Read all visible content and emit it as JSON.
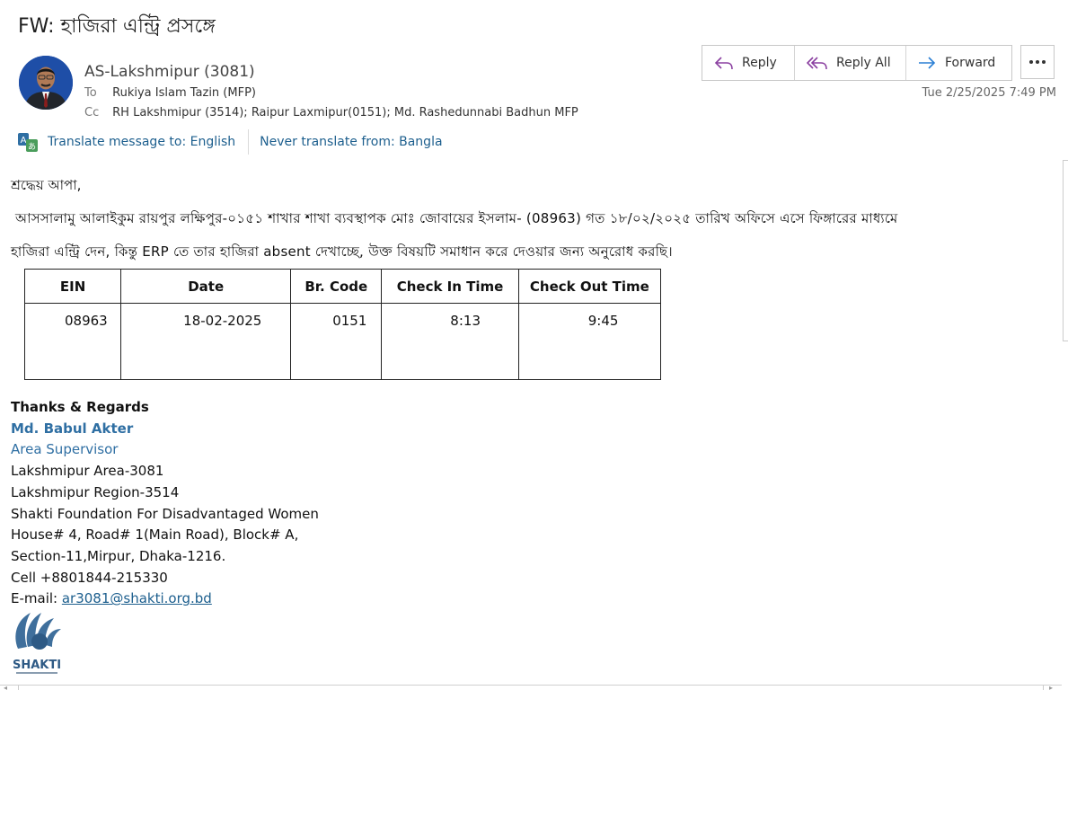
{
  "subject": "FW: হাজিরা এন্ট্রি প্রসঙ্গে",
  "header": {
    "sender": "AS-Lakshmipur (3081)",
    "to_label": "To",
    "to": "Rukiya Islam Tazin (MFP)",
    "cc_label": "Cc",
    "cc": "RH Lakshmipur (3514); Raipur Laxmipur(0151); Md. Rashedunnabi Badhun MFP",
    "timestamp": "Tue 2/25/2025 7:49 PM"
  },
  "toolbar": {
    "reply_label": "Reply",
    "reply_all_label": "Reply All",
    "forward_label": "Forward",
    "more_icon": "more-options-icon"
  },
  "translate": {
    "translate_label": "Translate message to: English",
    "never_label": "Never translate from: Bangla"
  },
  "body": {
    "salutation": "শ্রদ্ধেয় আপা,",
    "line2": "আসসালামু আলাইকুম রায়পুর লক্ষিপুর-০১৫১ শাখার শাখা ব্যবস্থাপক মোঃ জোবায়ের ইসলাম- (08963) গত ১৮/০২/২০২৫ তারিখ অফিসে এসে ফিঙ্গারের মাধ্যমে",
    "line3": "হাজিরা এন্ট্রি দেন, কিন্তু ERP তে তার হাজিরা absent দেখাচ্ছে, উক্ত বিষয়টি সমাধান করে দেওয়ার জন্য অনুরোধ করছি।"
  },
  "table": {
    "headers": [
      "EIN",
      "Date",
      "Br. Code",
      "Check In Time",
      "Check Out Time"
    ],
    "rows": [
      [
        "08963",
        "18-02-2025",
        "0151",
        "8:13",
        "9:45"
      ]
    ]
  },
  "signature": {
    "closing": "Thanks & Regards",
    "name": "Md. Babul Akter",
    "title": "Area Supervisor",
    "area": "Lakshmipur Area-3081",
    "region": "Lakshmipur Region-3514",
    "org": "Shakti Foundation For Disadvantaged Women",
    "address1": "House# 4, Road# 1(Main Road), Block# A,",
    "address2": "Section-11,Mirpur, Dhaka-1216.",
    "cell": "Cell +8801844-215330",
    "email_label": "E-mail: ",
    "email": "ar3081@shakti.org.bd",
    "logo_text": "SHAKTI"
  },
  "colors": {
    "link": "#1d5f8e",
    "signature_blue": "#2f6fa3",
    "reply_icon": "#8a3fa0",
    "forward_icon": "#2a7fd4"
  }
}
